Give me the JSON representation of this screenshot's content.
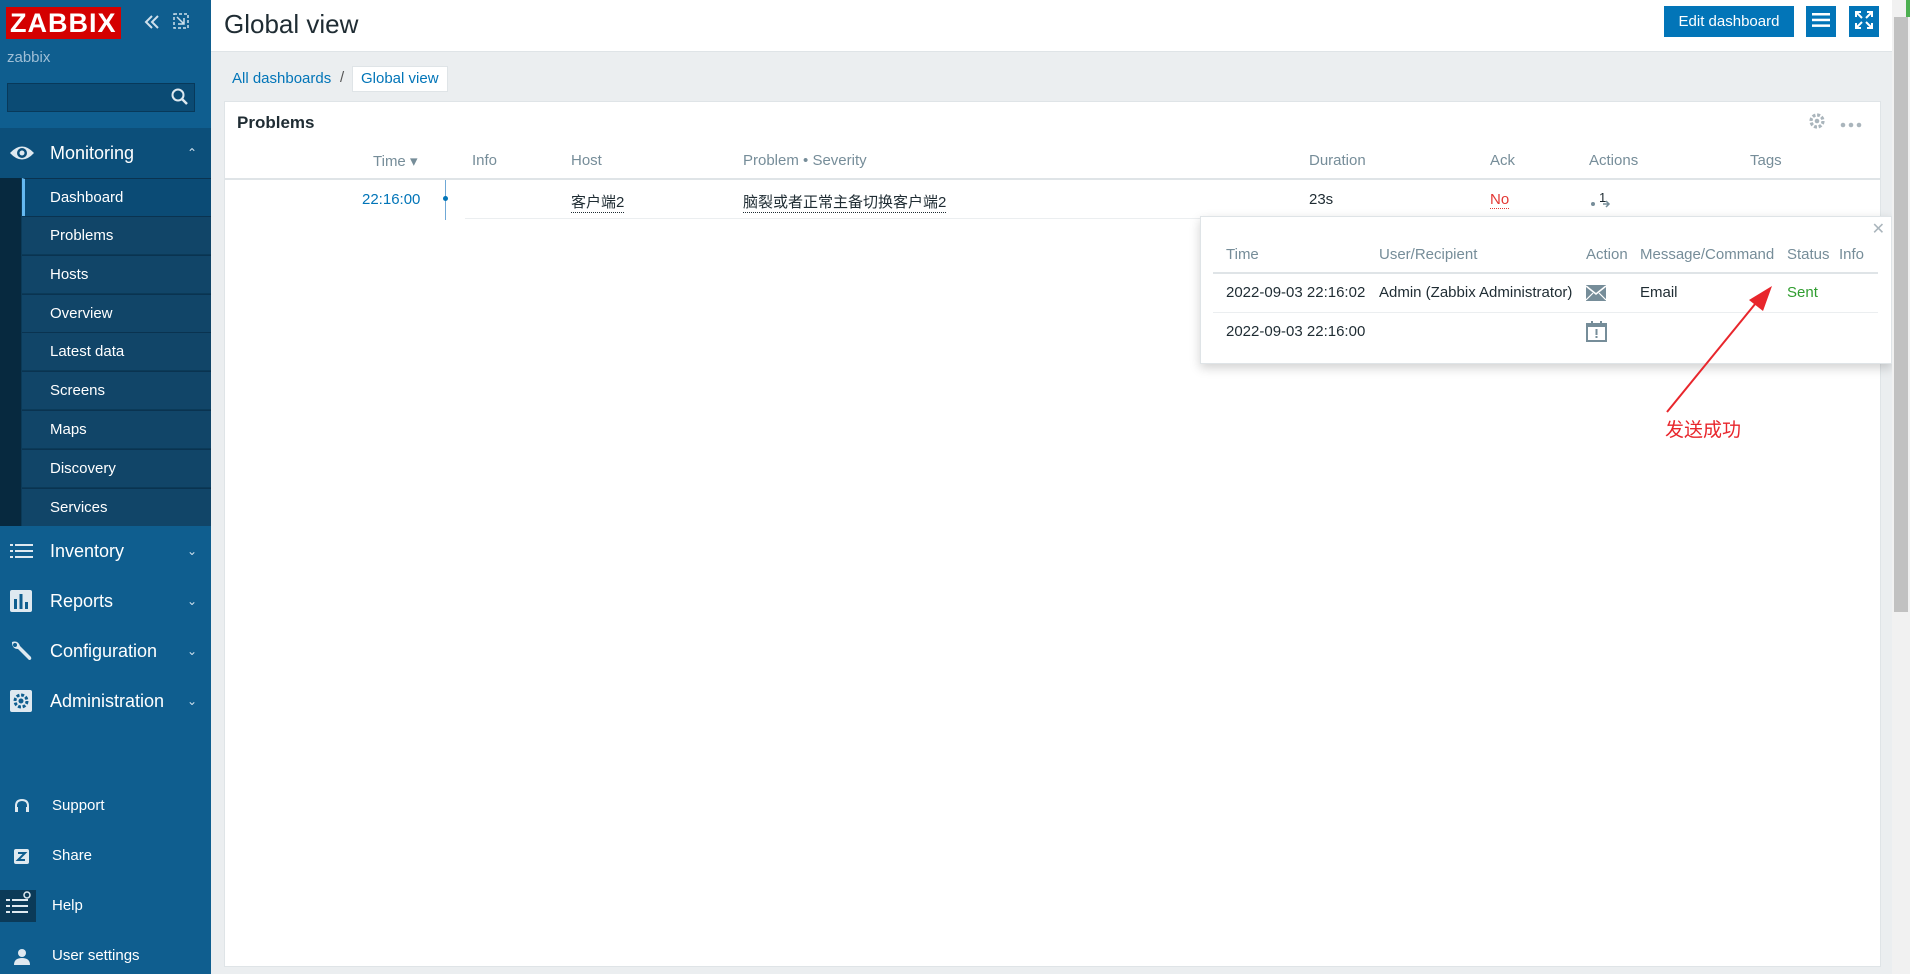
{
  "sidebar": {
    "logo": "ZABBIX",
    "server_name": "zabbix",
    "search": {
      "value": "",
      "placeholder": ""
    },
    "sections": {
      "monitoring": {
        "label": "Monitoring",
        "chevron": "⌃"
      },
      "inventory": {
        "label": "Inventory",
        "chevron": "⌄"
      },
      "reports": {
        "label": "Reports",
        "chevron": "⌄"
      },
      "configuration": {
        "label": "Configuration",
        "chevron": "⌄"
      },
      "administration": {
        "label": "Administration",
        "chevron": "⌄"
      }
    },
    "monitoring_items": [
      "Dashboard",
      "Problems",
      "Hosts",
      "Overview",
      "Latest data",
      "Screens",
      "Maps",
      "Discovery",
      "Services"
    ],
    "active_item": "Dashboard",
    "footer": {
      "support": "Support",
      "share": "Share",
      "help": "Help",
      "user_settings": "User settings"
    }
  },
  "header": {
    "title": "Global view",
    "edit_button": "Edit dashboard"
  },
  "breadcrumb": {
    "parent": "All dashboards",
    "separator": "/",
    "current": "Global view"
  },
  "widget": {
    "title": "Problems",
    "columns": {
      "time": "Time ▾",
      "info": "Info",
      "host": "Host",
      "problem": "Problem • Severity",
      "duration": "Duration",
      "ack": "Ack",
      "actions": "Actions",
      "tags": "Tags"
    },
    "row": {
      "time": "22:16:00",
      "host": "客户端2",
      "problem": "脑裂或者正常主备切换客户端2",
      "duration": "23s",
      "ack": "No",
      "actions_count": "1"
    }
  },
  "popup": {
    "columns": {
      "time": "Time",
      "user": "User/Recipient",
      "action": "Action",
      "message": "Message/Command",
      "status": "Status",
      "info": "Info"
    },
    "rows": [
      {
        "time": "2022-09-03 22:16:02",
        "user": "Admin (Zabbix Administrator)",
        "action_icon": "envelope-icon",
        "message": "Email",
        "status": "Sent"
      },
      {
        "time": "2022-09-03 22:16:00",
        "user": "",
        "action_icon": "calendar-alert-icon",
        "message": "",
        "status": ""
      }
    ]
  },
  "annotation": {
    "text": "发送成功",
    "color": "#e8262c"
  },
  "colors": {
    "sidebar_bg": "#0f5e8f",
    "accent_blue": "#0275b8",
    "logo_red": "#d40000",
    "status_sent": "#2f9d2f",
    "ack_no": "#e33734"
  }
}
